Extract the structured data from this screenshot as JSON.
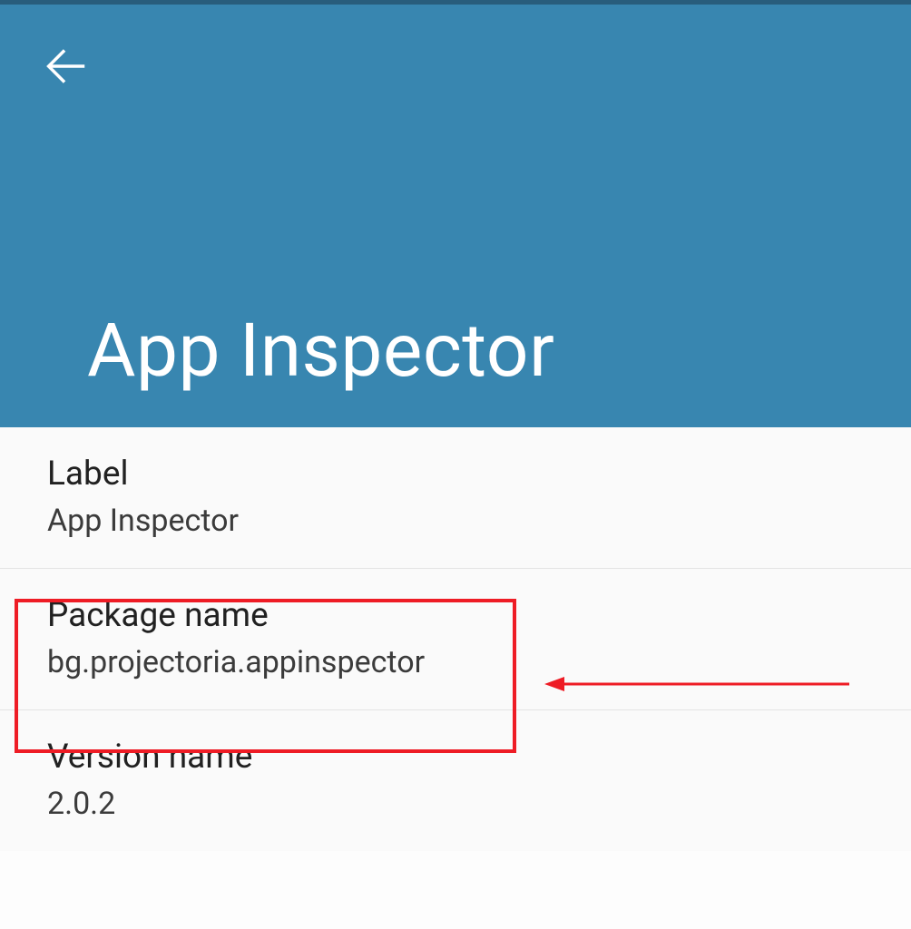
{
  "header": {
    "title": "App Inspector"
  },
  "rows": {
    "label": {
      "title": "Label",
      "value": "App Inspector"
    },
    "package": {
      "title": "Package name",
      "value": "bg.projectoria.appinspector"
    },
    "version": {
      "title": "Version name",
      "value": "2.0.2"
    }
  }
}
